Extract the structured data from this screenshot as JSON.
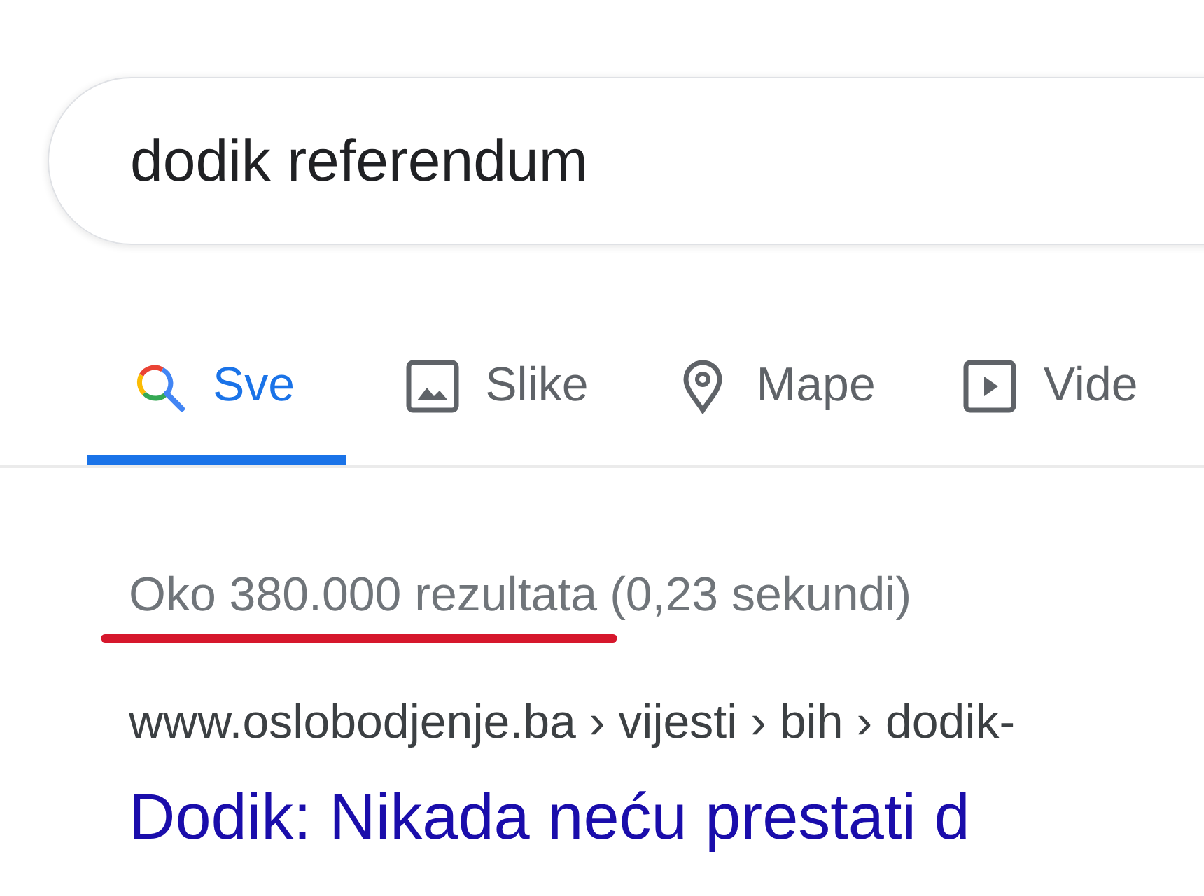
{
  "search": {
    "value": "dodik referendum"
  },
  "tabs": [
    {
      "label": "Sve",
      "kind": "all",
      "selected": true
    },
    {
      "label": "Slike",
      "kind": "images",
      "selected": false
    },
    {
      "label": "Mape",
      "kind": "maps",
      "selected": false
    },
    {
      "label": "Vide",
      "kind": "videos",
      "selected": false
    }
  ],
  "result_stats": {
    "count": "Oko 380.000 rezultata",
    "time": "(0,23 sekundi)",
    "underlined": true
  },
  "results": [
    {
      "breadcrumb": "www.oslobodjenje.ba › vijesti › bih › dodik-",
      "title": "Dodik: Nikada neću prestati d"
    }
  ]
}
